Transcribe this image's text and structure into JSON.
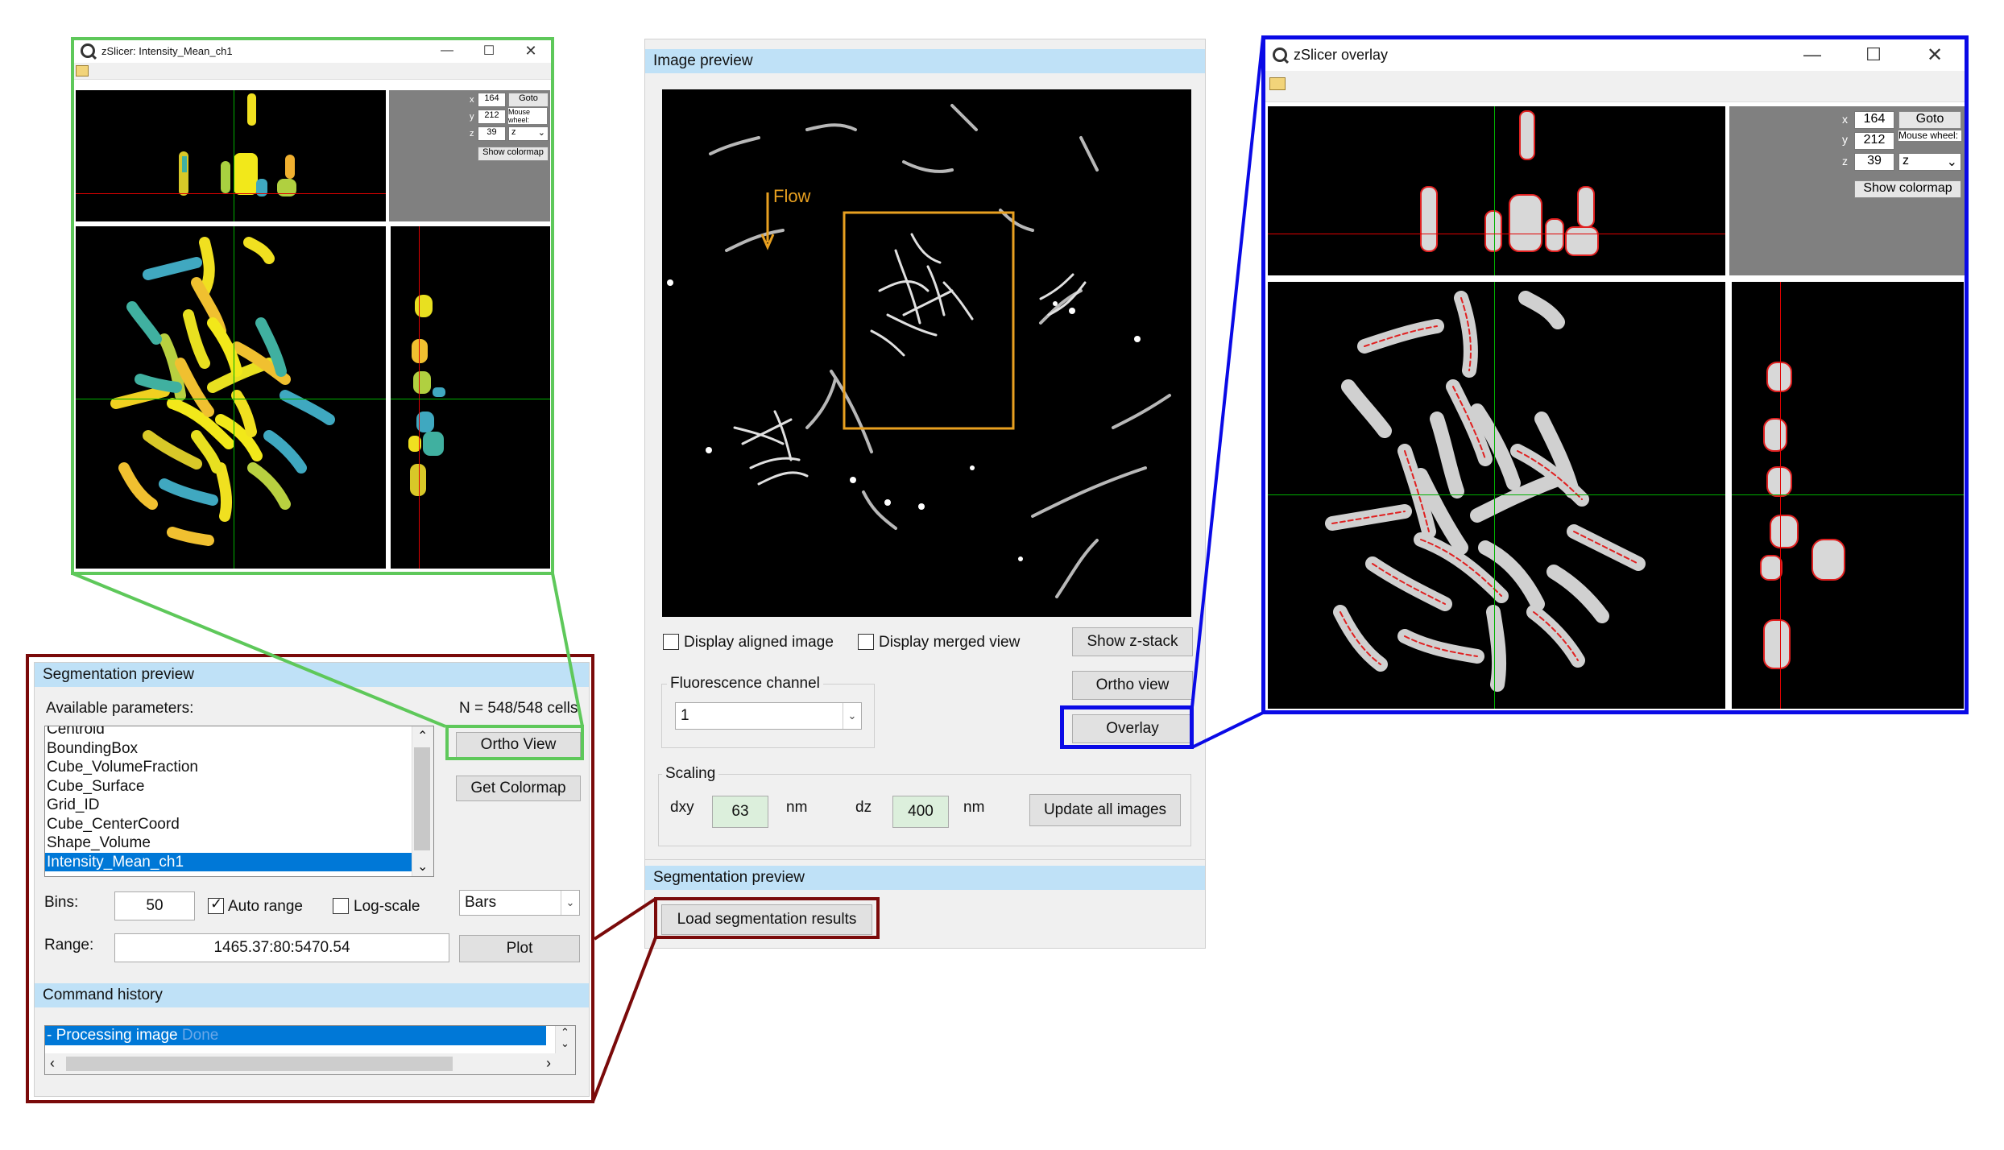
{
  "colors": {
    "green_highlight": "#5ec85a",
    "blue_highlight": "#0a0ae6",
    "red_highlight": "#7a0a0a",
    "panel_header": "#bfe1f7",
    "selection": "#0078d7",
    "orange_annotation": "#e8a020"
  },
  "left_window": {
    "title": "zSlicer: Intensity_Mean_ch1",
    "minimize_icon": "minimize-icon",
    "maximize_icon": "maximize-icon",
    "close_icon": "close-icon",
    "controls": {
      "x_label": "x",
      "x_value": "164",
      "y_label": "y",
      "y_value": "212",
      "z_label": "z",
      "z_value": "39",
      "goto_label": "Goto",
      "mouse_wheel_label": "Mouse wheel:",
      "axis_select": "z",
      "colormap_label": "Show colormap"
    }
  },
  "right_window": {
    "title": "zSlicer overlay",
    "controls": {
      "x_label": "x",
      "x_value": "164",
      "y_label": "y",
      "y_value": "212",
      "z_label": "z",
      "z_value": "39",
      "goto_label": "Goto",
      "mouse_wheel_label": "Mouse wheel:",
      "axis_select": "z",
      "colormap_label": "Show colormap"
    }
  },
  "center_panel": {
    "image_preview_header": "Image preview",
    "flow_label": "Flow",
    "display_aligned_label": "Display aligned image",
    "display_merged_label": "Display merged view",
    "show_zstack_label": "Show z-stack",
    "ortho_view_label": "Ortho view",
    "overlay_label": "Overlay",
    "fluorescence_channel_label": "Fluorescence channel",
    "channel_value": "1",
    "scaling_label": "Scaling",
    "dxy_label": "dxy",
    "dxy_value": "63",
    "dxy_unit": "nm",
    "dz_label": "dz",
    "dz_value": "400",
    "dz_unit": "nm",
    "update_all_label": "Update all images",
    "segmentation_header": "Segmentation preview",
    "load_segmentation_label": "Load segmentation results"
  },
  "seg_panel": {
    "header": "Segmentation preview",
    "available_params_label": "Available parameters:",
    "count_label": "N = 548/548 cells",
    "params": [
      "Centroid",
      "BoundingBox",
      "Cube_VolumeFraction",
      "Cube_Surface",
      "Grid_ID",
      "Cube_CenterCoord",
      "Shape_Volume",
      "Intensity_Mean_ch1"
    ],
    "selected_param": "Intensity_Mean_ch1",
    "ortho_view_label": "Ortho View",
    "get_colormap_label": "Get Colormap",
    "bins_label": "Bins:",
    "bins_value": "50",
    "auto_range_label": "Auto range",
    "log_scale_label": "Log-scale",
    "plot_type": "Bars",
    "range_label": "Range:",
    "range_value": "1465.37:80:5470.54",
    "plot_label": "Plot",
    "history_header": "Command history",
    "history_item": "- Processing image",
    "history_status": "Done"
  }
}
